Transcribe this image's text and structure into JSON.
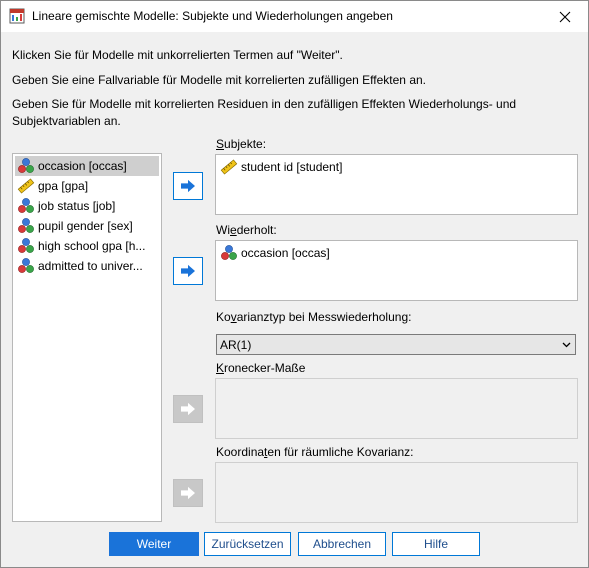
{
  "window": {
    "title": "Lineare gemischte Modelle: Subjekte und Wiederholungen angeben"
  },
  "instructions": [
    "Klicken Sie für Modelle mit unkorrelierten Termen auf \"Weiter\".",
    "Geben Sie eine Fallvariable für Modelle mit korrelierten zufälligen Effekten an.",
    "Geben Sie für Modelle mit korrelierten Residuen in den zufälligen Effekten Wiederholungs- und",
    "Subjektvariablen an."
  ],
  "variables": [
    {
      "label": "occasion [occas]",
      "icon": "nominal-icon",
      "selected": true
    },
    {
      "label": "gpa [gpa]",
      "icon": "scale-icon",
      "selected": false
    },
    {
      "label": "job status [job]",
      "icon": "nominal-icon",
      "selected": false
    },
    {
      "label": "pupil gender [sex]",
      "icon": "nominal-icon",
      "selected": false
    },
    {
      "label": "high school gpa [h...",
      "icon": "nominal-icon",
      "selected": false
    },
    {
      "label": "admitted to univer...",
      "icon": "nominal-icon",
      "selected": false
    }
  ],
  "subjects": {
    "label_pre": "",
    "label_accel": "S",
    "label_post": "ubjekte:",
    "items": [
      {
        "label": "student id [student]",
        "icon": "scale-icon"
      }
    ]
  },
  "repeated": {
    "label_pre": "Wi",
    "label_accel": "e",
    "label_post": "derholt:",
    "items": [
      {
        "label": "occasion [occas]",
        "icon": "nominal-icon"
      }
    ]
  },
  "covariance": {
    "label_pre": "Ko",
    "label_accel": "v",
    "label_post": "arianztyp bei Messwiederholung:",
    "selected": "AR(1)"
  },
  "kronecker": {
    "label_pre": "",
    "label_accel": "K",
    "label_post": "ronecker-Maße"
  },
  "spatial": {
    "label_pre": "Koordina",
    "label_accel": "t",
    "label_post": "en für räumliche Kovarianz:"
  },
  "buttons": {
    "continue": "Weiter",
    "reset": "Zurücksetzen",
    "cancel": "Abbrechen",
    "help": "Hilfe"
  },
  "colors": {
    "accent": "#0078d7",
    "primary_button": "#1a73d9",
    "selection": "#cfcfcf"
  }
}
